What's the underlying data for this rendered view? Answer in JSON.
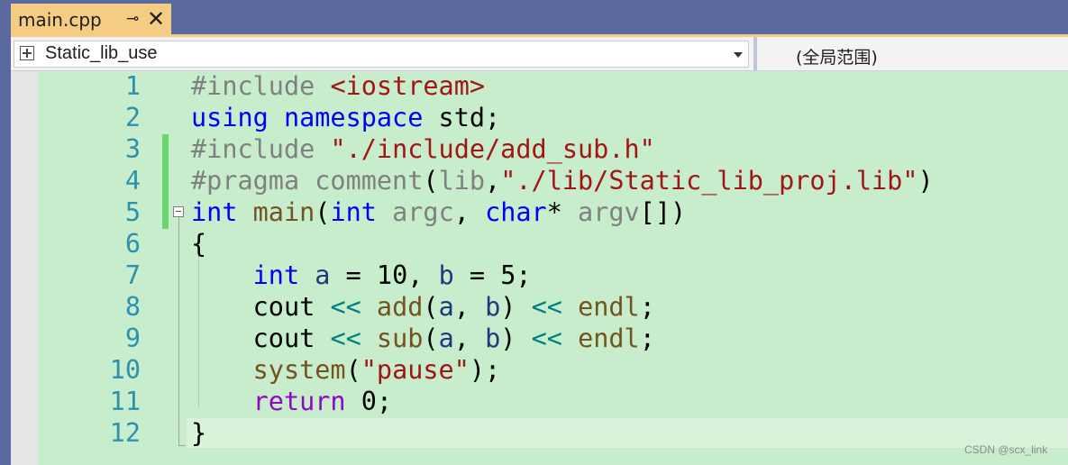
{
  "tab": {
    "title": "main.cpp",
    "pin_glyph": "⊸",
    "close_glyph": "✕"
  },
  "nav": {
    "context": "Static_lib_use",
    "scope": "(全局范围)"
  },
  "editor": {
    "line_numbers": [
      "1",
      "2",
      "3",
      "4",
      "5",
      "6",
      "7",
      "8",
      "9",
      "10",
      "11",
      "12"
    ],
    "lines": [
      [
        {
          "t": "#include ",
          "c": "pp"
        },
        {
          "t": "<iostream>",
          "c": "inc"
        }
      ],
      [
        {
          "t": "using namespace ",
          "c": "kw"
        },
        {
          "t": "std;",
          "c": "plain"
        }
      ],
      [
        {
          "t": "#include ",
          "c": "pp"
        },
        {
          "t": "\"./include/add_sub.h\"",
          "c": "str"
        }
      ],
      [
        {
          "t": "#pragma comment",
          "c": "pp"
        },
        {
          "t": "(",
          "c": "plain"
        },
        {
          "t": "lib",
          "c": "pp"
        },
        {
          "t": ",",
          "c": "plain"
        },
        {
          "t": "\"./lib/Static_lib_proj.lib\"",
          "c": "str"
        },
        {
          "t": ")",
          "c": "plain"
        }
      ],
      [
        {
          "t": "int ",
          "c": "kw"
        },
        {
          "t": "main",
          "c": "fn"
        },
        {
          "t": "(",
          "c": "plain"
        },
        {
          "t": "int ",
          "c": "kw"
        },
        {
          "t": "argc",
          "c": "pp"
        },
        {
          "t": ", ",
          "c": "plain"
        },
        {
          "t": "char",
          "c": "kw"
        },
        {
          "t": "* ",
          "c": "plain"
        },
        {
          "t": "argv",
          "c": "pp"
        },
        {
          "t": "[])",
          "c": "plain"
        }
      ],
      [
        {
          "t": "{",
          "c": "plain"
        }
      ],
      [
        {
          "t": "    ",
          "c": "plain"
        },
        {
          "t": "int ",
          "c": "kw"
        },
        {
          "t": "a",
          "c": "id"
        },
        {
          "t": " = 10, ",
          "c": "plain"
        },
        {
          "t": "b",
          "c": "id"
        },
        {
          "t": " = 5;",
          "c": "plain"
        }
      ],
      [
        {
          "t": "    cout ",
          "c": "plain"
        },
        {
          "t": "<< ",
          "c": "op"
        },
        {
          "t": "add",
          "c": "fn"
        },
        {
          "t": "(",
          "c": "plain"
        },
        {
          "t": "a",
          "c": "id"
        },
        {
          "t": ", ",
          "c": "plain"
        },
        {
          "t": "b",
          "c": "id"
        },
        {
          "t": ") ",
          "c": "plain"
        },
        {
          "t": "<< ",
          "c": "op"
        },
        {
          "t": "endl",
          "c": "fn"
        },
        {
          "t": ";",
          "c": "plain"
        }
      ],
      [
        {
          "t": "    cout ",
          "c": "plain"
        },
        {
          "t": "<< ",
          "c": "op"
        },
        {
          "t": "sub",
          "c": "fn"
        },
        {
          "t": "(",
          "c": "plain"
        },
        {
          "t": "a",
          "c": "id"
        },
        {
          "t": ", ",
          "c": "plain"
        },
        {
          "t": "b",
          "c": "id"
        },
        {
          "t": ") ",
          "c": "plain"
        },
        {
          "t": "<< ",
          "c": "op"
        },
        {
          "t": "endl",
          "c": "fn"
        },
        {
          "t": ";",
          "c": "plain"
        }
      ],
      [
        {
          "t": "    ",
          "c": "plain"
        },
        {
          "t": "system",
          "c": "fn"
        },
        {
          "t": "(",
          "c": "plain"
        },
        {
          "t": "\"pause\"",
          "c": "str"
        },
        {
          "t": ");",
          "c": "plain"
        }
      ],
      [
        {
          "t": "    ",
          "c": "plain"
        },
        {
          "t": "return ",
          "c": "ret"
        },
        {
          "t": "0;",
          "c": "plain"
        }
      ],
      [
        {
          "t": "}",
          "c": "plain"
        }
      ]
    ]
  },
  "watermark": "CSDN @scx_link"
}
